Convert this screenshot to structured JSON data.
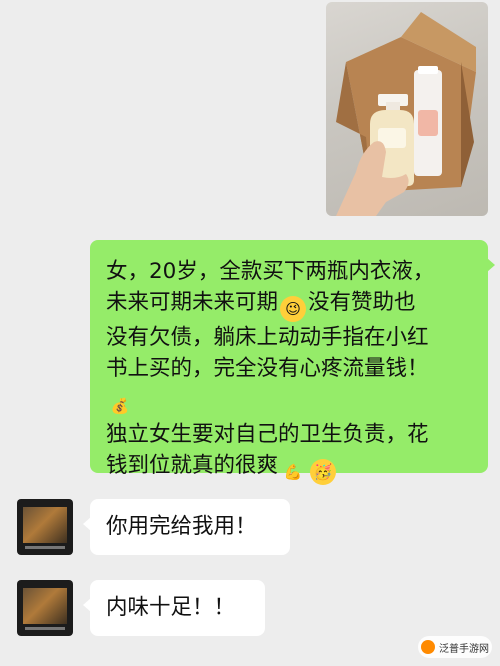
{
  "messages": {
    "sent": {
      "lines": [
        "女，20岁，全款买下两瓶内衣液，",
        "未来可期未来可期",
        "没有赞助也",
        "没有欠债，躺床上动动手指在小红",
        "书上买的，完全没有心疼流量钱！",
        "独立女生要对自己的卫生负责，花",
        "钱到位就真的很爽"
      ]
    },
    "received": [
      {
        "text": "你用完给我用！"
      },
      {
        "text": "内味十足！！"
      }
    ]
  },
  "watermark": {
    "text": "泛普手游网"
  },
  "icons": [
    "wink-emoji-icon",
    "money-bag-emoji-icon",
    "flexed-biceps-emoji-icon",
    "partying-face-emoji-icon"
  ],
  "colors": {
    "background": "#ededed",
    "sent_bubble": "#95ec69",
    "received_bubble": "#ffffff"
  }
}
